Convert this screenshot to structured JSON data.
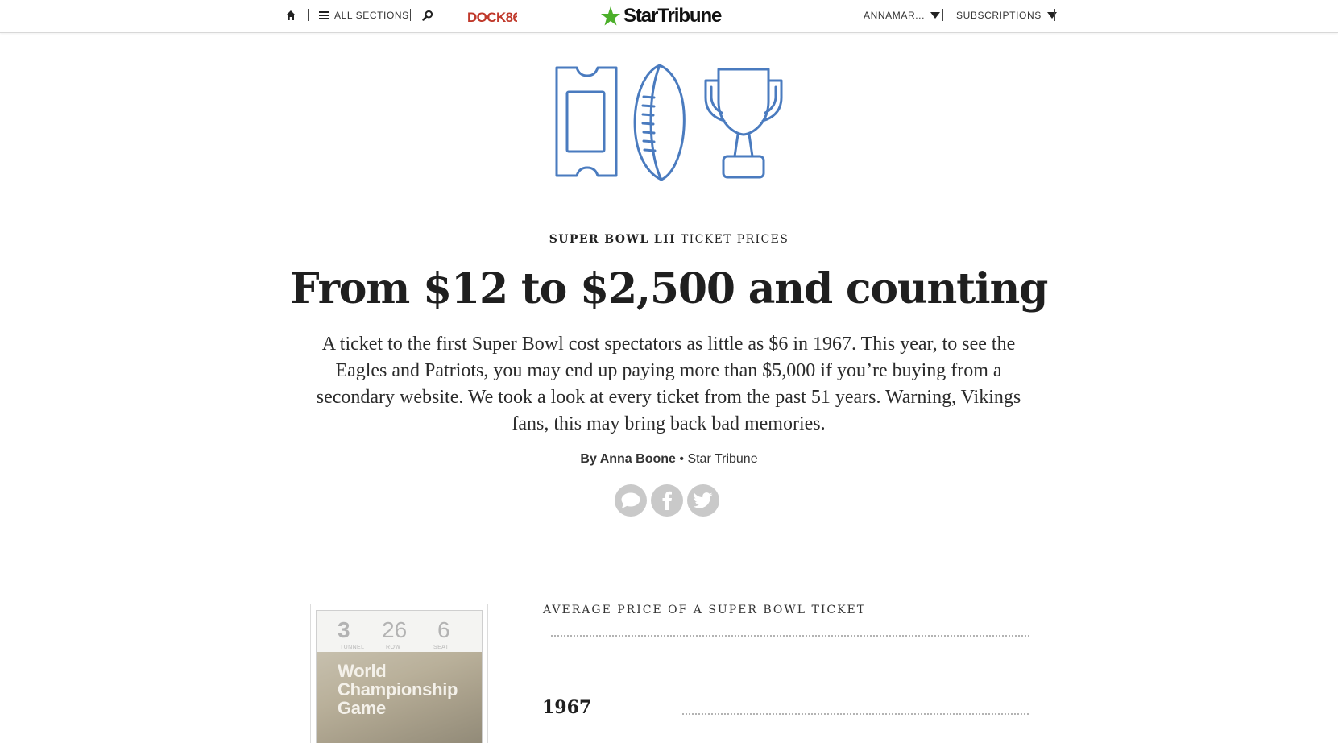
{
  "nav": {
    "sections_label": "ALL SECTIONS",
    "partner_logo_text": "DOCK86",
    "site_logo_text": "StarTribune",
    "account_label": "ANNAMAR...",
    "subscriptions_label": "SUBSCRIPTIONS"
  },
  "article": {
    "kicker_bold": "SUPER BOWL LII",
    "kicker_rest": "TICKET PRICES",
    "headline": "From $12 to $2,500 and counting",
    "dek": "A ticket to the first Super Bowl cost spectators as little as $6 in 1967. This year, to see the Eagles and Patriots, you may end up paying more than $5,000 if you’re buying from a secondary website. We took a look at every ticket from the past 51 years. Warning, Vikings fans, this may bring back bad memories.",
    "byline_author": "By Anna Boone",
    "byline_separator": "•",
    "byline_outlet": "Star Tribune"
  },
  "ticket": {
    "tunnel": "3",
    "tunnel_label": "TUNNEL",
    "row": "26",
    "row_label": "ROW",
    "seat": "6",
    "seat_label": "SEAT",
    "title": "World Championship Game"
  },
  "chart": {
    "label": "AVERAGE PRICE OF A SUPER BOWL TICKET",
    "first_year": "1967"
  },
  "colors": {
    "illustration_stroke": "#4a7bbf",
    "share_button_bg": "#c9c9c9",
    "logo_star": "#4caf2a",
    "dock_red": "#c0392b"
  },
  "icons": {
    "home": "home-icon",
    "menu": "hamburger-icon",
    "search": "search-icon",
    "comment": "comment-icon",
    "facebook": "facebook-icon",
    "twitter": "twitter-icon",
    "hero": [
      "ticket-icon",
      "football-icon",
      "trophy-icon"
    ]
  }
}
